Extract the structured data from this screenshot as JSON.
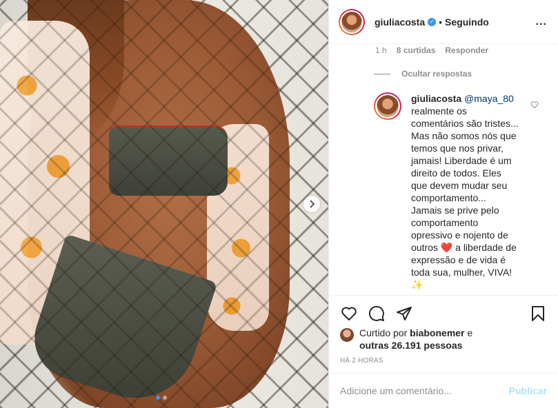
{
  "post": {
    "slide_count": 2,
    "active_slide": 1
  },
  "header": {
    "username": "giuliacosta",
    "verified_icon": "verified-badge-icon",
    "separator": "•",
    "follow_status": "Seguindo",
    "more_icon": "more-options-icon",
    "more_glyph": "..."
  },
  "comment_meta": {
    "time": "1 h",
    "likes": "8 curtidas",
    "reply": "Responder"
  },
  "hide_replies": "Ocultar respostas",
  "reply": {
    "username": "giuliacosta",
    "mention": "@maya_80",
    "text_1": "realmente os comentários são tristes... Mas não somos nós que temos que nos privar, jamais! Liberdade é um direito de todos. Eles que devem mudar seu comportamento... Jamais se prive pelo comportamento opressivo e nojento de outros",
    "heart_emoji": "❤️",
    "text_2": "a liberdade de expressão e de vida é toda sua, mulher, VIVA!",
    "sparkle_emoji": "✨"
  },
  "actions": {
    "like_icon": "heart-icon",
    "comment_icon": "comment-icon",
    "share_icon": "share-icon",
    "save_icon": "bookmark-icon"
  },
  "likes": {
    "prefix": "Curtido por",
    "user": "biabonemer",
    "conj": "e",
    "others": "outras 26.191 pessoas"
  },
  "posted_ago": "HÁ 2 HORAS",
  "comment_box": {
    "placeholder": "Adicione um comentário...",
    "publish": "Publicar"
  },
  "colors": {
    "accent": "#3897f0",
    "publish_disabled": "#b2dffc",
    "heart_red": "#ed4956"
  }
}
